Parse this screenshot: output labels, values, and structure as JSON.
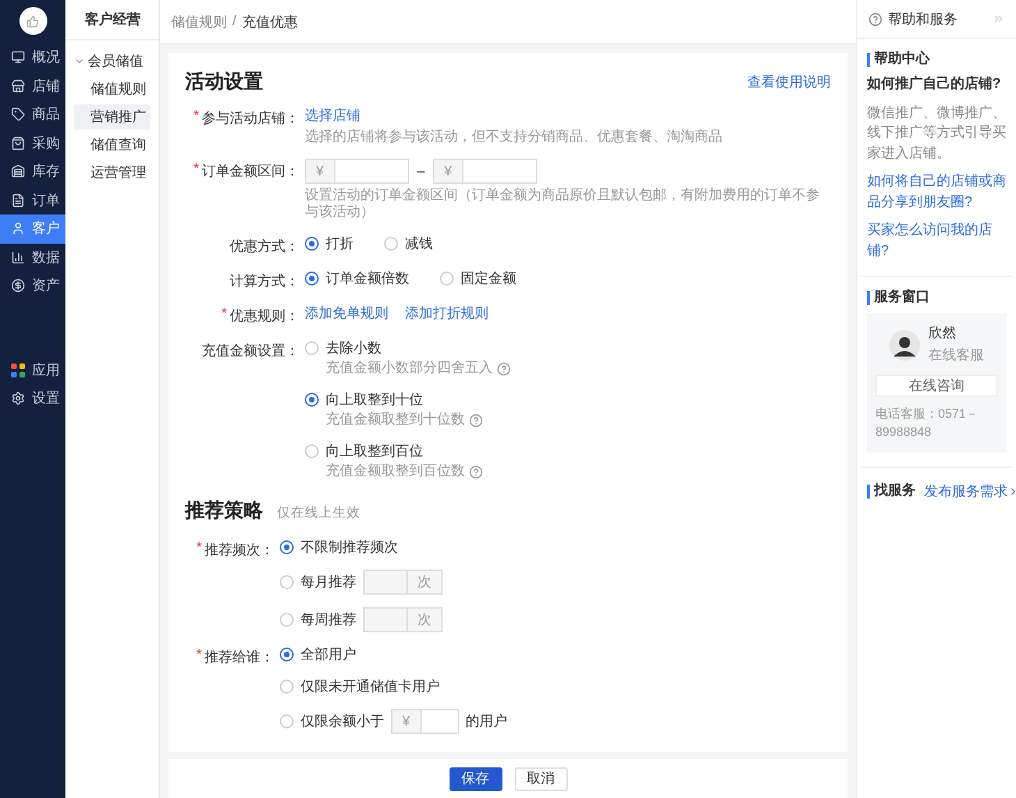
{
  "sidebar": {
    "nav": [
      {
        "label": "概况",
        "selected": false
      },
      {
        "label": "店铺",
        "selected": false
      },
      {
        "label": "商品",
        "selected": false
      },
      {
        "label": "采购",
        "selected": false
      },
      {
        "label": "库存",
        "selected": false
      },
      {
        "label": "订单",
        "selected": false
      },
      {
        "label": "客户",
        "selected": true
      },
      {
        "label": "数据",
        "selected": false
      },
      {
        "label": "资产",
        "selected": false
      }
    ],
    "bottom": [
      {
        "label": "应用"
      },
      {
        "label": "设置"
      }
    ]
  },
  "subnav": {
    "title": "客户经营",
    "group": {
      "label": "会员储值",
      "expanded": true,
      "children": [
        {
          "label": "储值规则",
          "selected": false
        },
        {
          "label": "营销推广",
          "selected": true
        },
        {
          "label": "储值查询",
          "selected": false
        },
        {
          "label": "运营管理",
          "selected": false
        }
      ]
    }
  },
  "breadcrumb": {
    "items": [
      "储值规则",
      "充值优惠"
    ],
    "separator": "/"
  },
  "form": {
    "title": "活动设置",
    "help_link": "查看使用说明",
    "rows": [
      {
        "label": "参与活动店铺：",
        "required_mark": "*",
        "kind": "links",
        "links": [
          "选择店铺"
        ],
        "hint": "选择的店铺将参与该活动，但不支持分销商品、优惠套餐、淘淘商品"
      },
      {
        "label": "订单金额区间：",
        "required_mark": "*",
        "kind": "range",
        "inputs": [
          {
            "prefix": "¥"
          },
          {
            "prefix": "¥"
          }
        ],
        "separator": "–",
        "hint": "设置活动的订单金额区间（订单金额为商品原价且默认包邮，有附加费用的订单不参与该活动）"
      },
      {
        "label": "优惠方式：",
        "kind": "radio_inline",
        "options": [
          {
            "label": "打折",
            "selected": true
          },
          {
            "label": "减钱",
            "selected": false
          }
        ]
      },
      {
        "label": "计算方式：",
        "kind": "radio_inline",
        "options": [
          {
            "label": "订单金额倍数",
            "selected": true
          },
          {
            "label": "固定金额",
            "selected": false
          }
        ]
      },
      {
        "label": "优惠规则：",
        "required_mark": "*",
        "kind": "links",
        "links": [
          "添加免单规则",
          "添加打折规则"
        ]
      },
      {
        "label": "充值金额设置：",
        "kind": "radio_stack",
        "options": [
          {
            "label": "去除小数",
            "selected": false,
            "hint": "充值金额小数部分四舍五入"
          },
          {
            "label": "向上取整到十位",
            "selected": true,
            "hint": "充值金额取整到十位数"
          },
          {
            "label": "向上取整到百位",
            "selected": false,
            "hint": "充值金额取整到百位数"
          }
        ]
      }
    ]
  },
  "strategy": {
    "title": "推荐策略",
    "note": "仅在线上生效",
    "rows": [
      {
        "label": "推荐频次：",
        "required_mark": "*",
        "kind": "radio_stack",
        "options": [
          {
            "label": "不限制推荐频次",
            "selected": true
          },
          {
            "label": "每月推荐",
            "selected": false,
            "input": {
              "suffix": "次"
            }
          },
          {
            "label": "每周推荐",
            "selected": false,
            "input": {
              "suffix": "次"
            }
          }
        ]
      },
      {
        "label": "推荐给谁：",
        "required_mark": "*",
        "kind": "radio_stack",
        "options": [
          {
            "label": "全部用户",
            "selected": true
          },
          {
            "label": "仅限未开通储值卡用户",
            "selected": false
          },
          {
            "label": "仅限余额小于",
            "selected": false,
            "input": {
              "prefix": "¥"
            },
            "after": "的用户"
          }
        ]
      }
    ]
  },
  "footer": {
    "buttons": [
      {
        "label": "保存",
        "kind": "primary"
      },
      {
        "label": "取消",
        "kind": "default"
      }
    ]
  },
  "help_panel": {
    "title": "帮助和服务",
    "sections": [
      {
        "title": "帮助中心",
        "kind": "articles",
        "question": "如何推广自己的店铺?",
        "answer": "微信推广、微博推广、线下推广等方式引导买家进入店铺。",
        "links": [
          "如何将自己的店铺或商品分享到朋友圈?",
          "买家怎么访问我的店铺?"
        ]
      },
      {
        "title": "服务窗口",
        "kind": "contact",
        "name": "欣然",
        "role": "在线客服",
        "button": "在线咨询",
        "phone": "电话客服：0571－89988848"
      },
      {
        "title": "找服务",
        "kind": "service",
        "link": "发布服务需求"
      }
    ]
  }
}
